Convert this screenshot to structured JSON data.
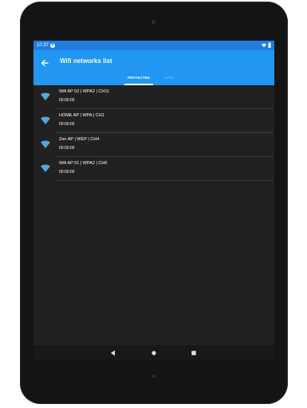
{
  "statusbar": {
    "time": "10:37",
    "notification_letter": "P"
  },
  "appbar": {
    "title": "Wifi networks list"
  },
  "tabs": {
    "protected_label": "PROTECTED",
    "open_label": "OPEN"
  },
  "networks": [
    {
      "title": "Wifi AP 02 | WPA2 | CH11",
      "time": "00:00:00"
    },
    {
      "title": "HOME AP | WPA | CH1",
      "time": "00:00:00"
    },
    {
      "title": "Zen AP | WEP | CH4",
      "time": "00:00:00"
    },
    {
      "title": "Wifi AP 01 | WPA2 | CH6",
      "time": "00:00:00"
    }
  ],
  "colors": {
    "accent": "#2196f3",
    "statusbar": "#1f7fe0",
    "wifi_icon": "#4fa8e0",
    "background": "#212121"
  },
  "icons": [
    "back-arrow-icon",
    "wifi-icon",
    "back-nav-icon",
    "home-nav-icon",
    "recents-nav-icon",
    "wifi-status-icon",
    "battery-icon"
  ]
}
